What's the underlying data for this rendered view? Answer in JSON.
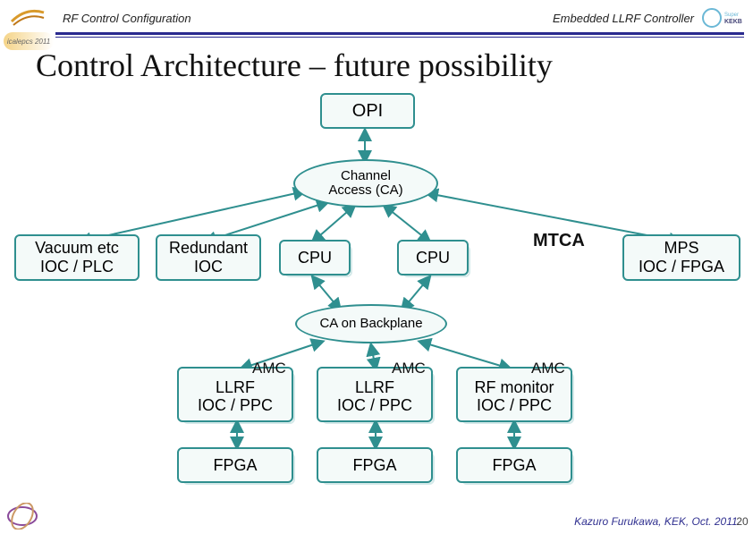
{
  "header": {
    "left": "RF Control Configuration",
    "right": "Embedded LLRF Controller",
    "badge": "icalepcs 2011"
  },
  "title": "Control Architecture – future possibility",
  "nodes": {
    "opi": "OPI",
    "ca": "Channel\nAccess (CA)",
    "vacuum": "Vacuum etc\nIOC / PLC",
    "redundant": "Redundant\nIOC",
    "cpu1": "CPU",
    "cpu2": "CPU",
    "mtca": "MTCA",
    "mps": "MPS\nIOC / FPGA",
    "ca_backplane": "CA on Backplane",
    "amc": "AMC",
    "llrf1": "LLRF\nIOC / PPC",
    "llrf2": "LLRF\nIOC / PPC",
    "rfmon": "RF monitor\nIOC / PPC",
    "fpga1": "FPGA",
    "fpga2": "FPGA",
    "fpga3": "FPGA"
  },
  "footer": {
    "credit": "Kazuro Furukawa, KEK, Oct. 2011.",
    "page": "20"
  }
}
